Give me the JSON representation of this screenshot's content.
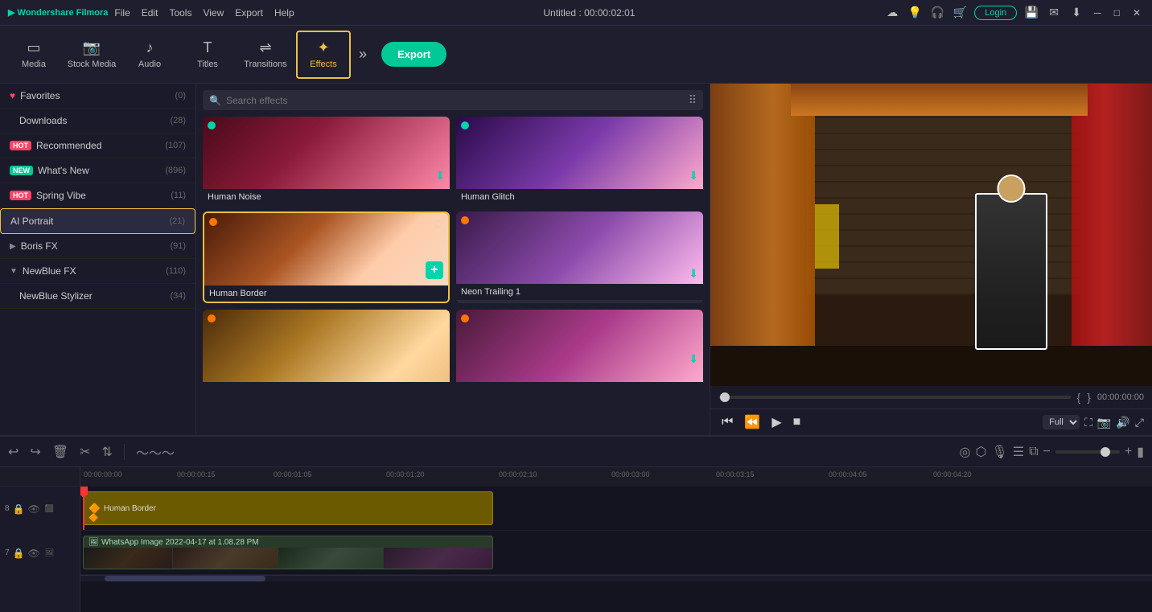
{
  "titlebar": {
    "logo": "▶ Wondershare Filmora",
    "menus": [
      "File",
      "Edit",
      "Tools",
      "View",
      "Export",
      "Help"
    ],
    "title": "Untitled : 00:00:02:01",
    "icons": [
      "cloud",
      "bulb",
      "headset",
      "cart"
    ],
    "login": "Login"
  },
  "toolbar": {
    "items": [
      {
        "id": "media",
        "icon": "☰",
        "label": "Media"
      },
      {
        "id": "stock",
        "icon": "📷",
        "label": "Stock Media"
      },
      {
        "id": "audio",
        "icon": "♪",
        "label": "Audio"
      },
      {
        "id": "titles",
        "icon": "T",
        "label": "Titles"
      },
      {
        "id": "transitions",
        "icon": "⇌",
        "label": "Transitions"
      },
      {
        "id": "effects",
        "icon": "✦",
        "label": "Effects",
        "active": true
      }
    ],
    "export": "Export"
  },
  "sidebar": {
    "items": [
      {
        "id": "favorites",
        "icon": "♥",
        "label": "Favorites",
        "count": "(0)",
        "badge": null
      },
      {
        "id": "downloads",
        "icon": "",
        "label": "Downloads",
        "count": "(28)",
        "badge": null,
        "indent": true
      },
      {
        "id": "recommended",
        "icon": "",
        "label": "Recommended",
        "count": "(107)",
        "badge": "HOT"
      },
      {
        "id": "whatsnew",
        "icon": "",
        "label": "What's New",
        "count": "(896)",
        "badge": "NEW"
      },
      {
        "id": "springvibe",
        "icon": "",
        "label": "Spring Vibe",
        "count": "(11)",
        "badge": "HOT"
      },
      {
        "id": "aiportrait",
        "icon": "",
        "label": "AI Portrait",
        "count": "(21)",
        "active": true
      },
      {
        "id": "borisfx",
        "icon": "",
        "label": "Boris FX",
        "count": "(91)",
        "arrow": "▶"
      },
      {
        "id": "newbluefx",
        "icon": "",
        "label": "NewBlue FX",
        "count": "(110)",
        "arrow": "▼"
      },
      {
        "id": "newbluestylizer",
        "icon": "",
        "label": "NewBlue Stylizer",
        "count": "(34)",
        "indent": true
      }
    ]
  },
  "search": {
    "placeholder": "Search effects"
  },
  "effects": [
    {
      "id": "human-noise",
      "label": "Human Noise",
      "badge": "teal",
      "has_dl": true
    },
    {
      "id": "human-glitch",
      "label": "Human Glitch",
      "badge": "teal",
      "has_dl": true
    },
    {
      "id": "human-border",
      "label": "Human Border",
      "badge": "orange",
      "has_heart": true,
      "has_plus": true,
      "selected": true
    },
    {
      "id": "neon-trailing",
      "label": "Neon Trailing 1",
      "badge": "orange",
      "has_dl": true
    },
    {
      "id": "effect5",
      "label": "",
      "badge": "orange",
      "has_dl": false
    },
    {
      "id": "effect6",
      "label": "",
      "badge": "orange",
      "has_dl": true
    }
  ],
  "preview": {
    "timecode": "00:00:00:00",
    "progress": "0",
    "quality": "Full"
  },
  "timeline": {
    "markers": [
      "00:00:00:00",
      "00:00:00:15",
      "00:00:01:05",
      "00:00:01:20",
      "00:00:02:10",
      "00:00:03:00",
      "00:00:03:15",
      "00:00:04:05",
      "00:00:04:20"
    ],
    "tracks": [
      {
        "num": "8",
        "clips": [
          {
            "label": "Human Border",
            "type": "effect"
          }
        ]
      },
      {
        "num": "7",
        "clips": [
          {
            "label": "WhatsApp Image 2022-04-17 at 1.08.28 PM",
            "type": "video"
          }
        ]
      }
    ]
  }
}
